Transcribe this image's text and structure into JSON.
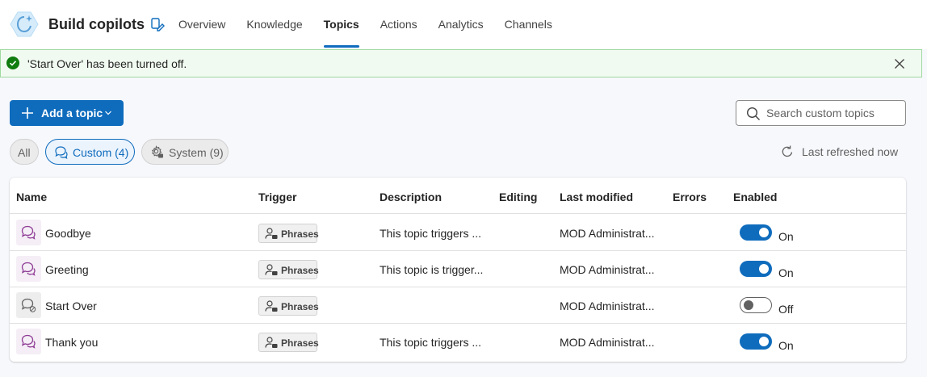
{
  "header": {
    "title": "Build copilots",
    "tabs": [
      {
        "label": "Overview",
        "active": false
      },
      {
        "label": "Knowledge",
        "active": false
      },
      {
        "label": "Topics",
        "active": true
      },
      {
        "label": "Actions",
        "active": false
      },
      {
        "label": "Analytics",
        "active": false
      },
      {
        "label": "Channels",
        "active": false
      }
    ]
  },
  "notification": {
    "text": "'Start Over' has been turned off.",
    "status": "success",
    "status_color": "#107c10",
    "close_icon": "close-icon"
  },
  "toolbar": {
    "add_label": "Add a topic",
    "search_placeholder": "Search custom topics",
    "refresh_label": "Last refreshed now"
  },
  "filters": {
    "all": "All",
    "custom": "Custom (4)",
    "system": "System (9)",
    "selected": "custom"
  },
  "table": {
    "columns": {
      "name": "Name",
      "trigger": "Trigger",
      "description": "Description",
      "editing": "Editing",
      "last_modified": "Last modified",
      "errors": "Errors",
      "enabled": "Enabled"
    },
    "rows": [
      {
        "name": "Goodbye",
        "trigger": "Phrases",
        "description": "This topic triggers ...",
        "last_modified": "MOD Administrat...",
        "enabled": true,
        "enabled_label": "On"
      },
      {
        "name": "Greeting",
        "trigger": "Phrases",
        "description": "This topic is trigger...",
        "last_modified": "MOD Administrat...",
        "enabled": true,
        "enabled_label": "On"
      },
      {
        "name": "Start Over",
        "trigger": "Phrases",
        "description": "",
        "last_modified": "MOD Administrat...",
        "enabled": false,
        "enabled_label": "Off"
      },
      {
        "name": "Thank you",
        "trigger": "Phrases",
        "description": "This topic triggers ...",
        "last_modified": "MOD Administrat...",
        "enabled": true,
        "enabled_label": "On"
      }
    ]
  },
  "colors": {
    "accent": "#0f6cbd",
    "topic_icon": "#8e3c95",
    "success_bg": "#f1faf1"
  }
}
